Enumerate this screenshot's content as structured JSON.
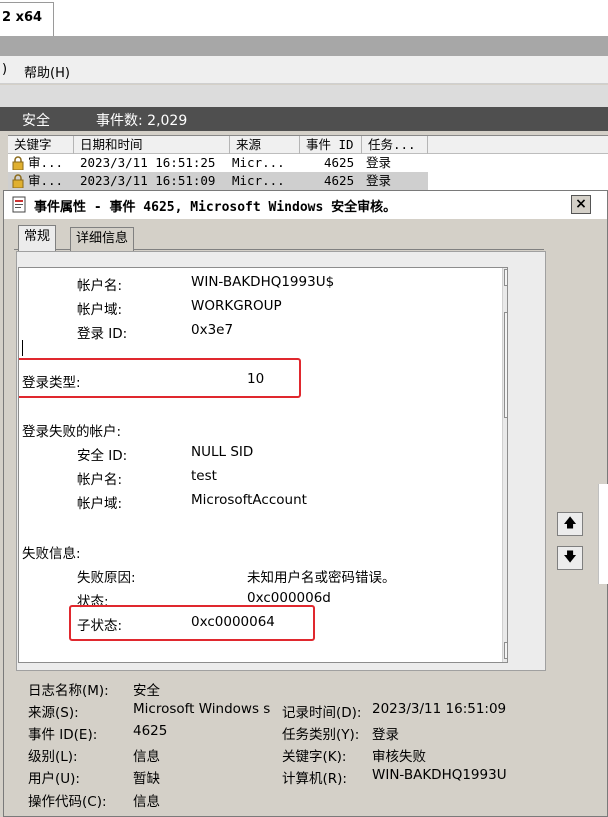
{
  "app_tab": {
    "label": "2 x64"
  },
  "menu": {
    "left_fragment": ")",
    "help": "帮助(H)"
  },
  "list_header": {
    "log_name": "安全",
    "event_count": "事件数: 2,029"
  },
  "columns": [
    "关键字",
    "日期和时间",
    "来源",
    "事件 ID",
    "任务..."
  ],
  "rows": [
    {
      "keyword": "审...",
      "datetime": "2023/3/11 16:51:25",
      "source": "Micr...",
      "event_id": "4625",
      "task": "登录"
    },
    {
      "keyword": "审...",
      "datetime": "2023/3/11 16:51:09",
      "source": "Micr...",
      "event_id": "4625",
      "task": "登录"
    }
  ],
  "dialog": {
    "title": "事件属性 - 事件 4625, Microsoft Windows 安全审核。",
    "close": "×",
    "tabs": [
      "常规",
      "详细信息"
    ]
  },
  "detail": {
    "account_name_label": "帐户名:",
    "account_name": "WIN-BAKDHQ1993U$",
    "account_domain_label": "帐户域:",
    "account_domain": "WORKGROUP",
    "logon_id_label": "登录 ID:",
    "logon_id": "0x3e7",
    "logon_type_label": "登录类型:",
    "logon_type": "10",
    "failed_account_heading": "登录失败的帐户:",
    "security_id_label": "安全 ID:",
    "security_id": "NULL SID",
    "failed_account_name_label": "帐户名:",
    "failed_account_name": "test",
    "failed_account_domain_label": "帐户域:",
    "failed_account_domain": "MicrosoftAccount",
    "failure_info_heading": "失败信息:",
    "failure_reason_label": "失败原因:",
    "failure_reason": "未知用户名或密码错误。",
    "status_label": "状态:",
    "status": "0xc000006d",
    "sub_status_label": "子状态:",
    "sub_status": "0xc0000064"
  },
  "meta": {
    "log_name_label": "日志名称(M):",
    "log_name": "安全",
    "source_label": "来源(S):",
    "source": "Microsoft Windows s",
    "logged_label": "记录时间(D):",
    "logged": "2023/3/11 16:51:09",
    "event_id_label": "事件 ID(E):",
    "event_id": "4625",
    "task_category_label": "任务类别(Y):",
    "task_category": "登录",
    "level_label": "级别(L):",
    "level": "信息",
    "keywords_label": "关键字(K):",
    "keywords": "审核失败",
    "user_label": "用户(U):",
    "user": "暂缺",
    "computer_label": "计算机(R):",
    "computer": "WIN-BAKDHQ1993U",
    "opcode_label": "操作代码(C):",
    "opcode": "信息"
  },
  "colors": {
    "highlight": "#e0282e",
    "list_header_bg": "#4f4f4f"
  }
}
